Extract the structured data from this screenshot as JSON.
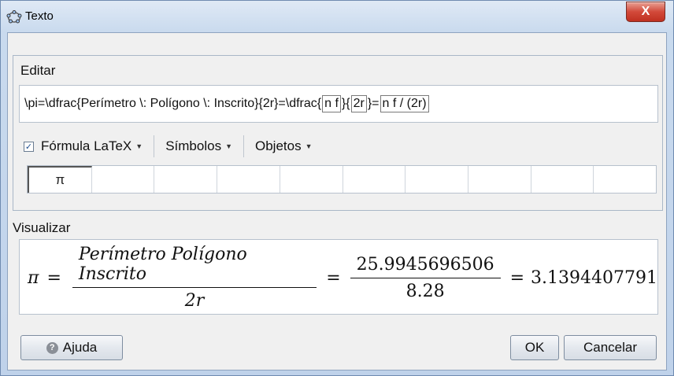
{
  "window": {
    "title": "Texto",
    "close_label": "X"
  },
  "edit": {
    "section_label": "Editar",
    "parts": {
      "prefix": "\\pi=\\dfrac{Perímetro \\: Polígono \\: Inscrito}{2r}=\\dfrac{",
      "box1": "n f",
      "mid1": "}{",
      "box2": "2r",
      "mid2": "}=",
      "box3": "n f / (2r)",
      "suffix": ")"
    }
  },
  "toolbar": {
    "latex_checked": true,
    "latex_label": "Fórmula LaTeX",
    "symbols_label": "Símbolos",
    "objects_label": "Objetos"
  },
  "symbols": [
    "π",
    "",
    "",
    "",
    "",
    "",
    "",
    "",
    "",
    ""
  ],
  "preview": {
    "section_label": "Visualizar",
    "lhs": "π",
    "eq": "=",
    "frac1_num": "Perímetro Polígono Inscrito",
    "frac1_den": "2r",
    "frac2_num": "25.9945696506",
    "frac2_den": "8.28",
    "result": "3.1394407791"
  },
  "buttons": {
    "help": "Ajuda",
    "ok": "OK",
    "cancel": "Cancelar"
  }
}
